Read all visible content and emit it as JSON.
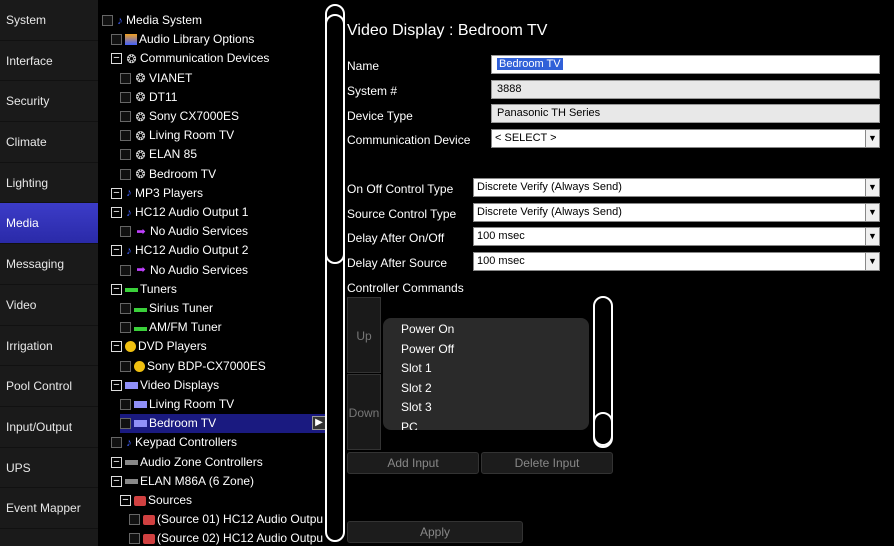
{
  "nav": {
    "items": [
      {
        "label": "System",
        "active": false
      },
      {
        "label": "Interface",
        "active": false
      },
      {
        "label": "Security",
        "active": false
      },
      {
        "label": "Climate",
        "active": false
      },
      {
        "label": "Lighting",
        "active": false
      },
      {
        "label": "Media",
        "active": true
      },
      {
        "label": "Messaging",
        "active": false
      },
      {
        "label": "Video",
        "active": false
      },
      {
        "label": "Irrigation",
        "active": false
      },
      {
        "label": "Pool Control",
        "active": false
      },
      {
        "label": "Input/Output",
        "active": false
      },
      {
        "label": "UPS",
        "active": false
      },
      {
        "label": "Event Mapper",
        "active": false
      }
    ]
  },
  "tree": {
    "items": [
      {
        "label": "Media System",
        "icon": "note-icon",
        "expander": "box"
      },
      {
        "label": "Audio Library Options",
        "icon": "library-icon",
        "expander": "box"
      },
      {
        "label": "Communication Devices",
        "icon": "satellite-icon",
        "expander": "minus"
      },
      {
        "label": "VIANET",
        "icon": "satellite-icon",
        "expander": "box"
      },
      {
        "label": "DT11",
        "icon": "satellite-icon",
        "expander": "box"
      },
      {
        "label": "Sony CX7000ES",
        "icon": "satellite-icon",
        "expander": "box"
      },
      {
        "label": "Living Room TV",
        "icon": "satellite-icon",
        "expander": "box"
      },
      {
        "label": "ELAN 85",
        "icon": "satellite-icon",
        "expander": "box"
      },
      {
        "label": "Bedroom TV",
        "icon": "satellite-icon",
        "expander": "box"
      },
      {
        "label": "MP3 Players",
        "icon": "note-icon",
        "expander": "minus"
      },
      {
        "label": "HC12 Audio Output 1",
        "icon": "note-icon",
        "expander": "minus"
      },
      {
        "label": "No Audio Services",
        "icon": "arrow-icon",
        "expander": "box"
      },
      {
        "label": "HC12 Audio Output 2",
        "icon": "note-icon",
        "expander": "minus"
      },
      {
        "label": "No Audio Services",
        "icon": "arrow-icon",
        "expander": "box"
      },
      {
        "label": "Tuners",
        "icon": "tuner-icon",
        "expander": "minus"
      },
      {
        "label": "Sirius Tuner",
        "icon": "tuner-icon",
        "expander": "box"
      },
      {
        "label": "AM/FM Tuner",
        "icon": "tuner-icon",
        "expander": "box"
      },
      {
        "label": "DVD Players",
        "icon": "disc-icon",
        "expander": "minus"
      },
      {
        "label": "Sony BDP-CX7000ES",
        "icon": "disc-icon",
        "expander": "box"
      },
      {
        "label": "Video Displays",
        "icon": "display-icon",
        "expander": "minus"
      },
      {
        "label": "Living Room TV",
        "icon": "display-icon",
        "expander": "box"
      },
      {
        "label": "Bedroom TV",
        "icon": "display-icon",
        "expander": "box",
        "selected": true
      },
      {
        "label": "Keypad Controllers",
        "icon": "note-icon",
        "expander": "box"
      },
      {
        "label": "Audio Zone Controllers",
        "icon": "controller-icon",
        "expander": "minus"
      },
      {
        "label": "ELAN M86A (6 Zone)",
        "icon": "controller-icon",
        "expander": "minus"
      },
      {
        "label": "Sources",
        "icon": "sources-icon",
        "expander": "minus"
      },
      {
        "label": "(Source 01) HC12 Audio Outpu",
        "icon": "sources-icon",
        "expander": "box"
      },
      {
        "label": "(Source 02) HC12 Audio Outpu",
        "icon": "sources-icon",
        "expander": "box"
      }
    ]
  },
  "form": {
    "title": "Video Display : Bedroom TV",
    "name_label": "Name",
    "name_value": "Bedroom TV",
    "system_label": "System #",
    "system_value": "3888",
    "device_type_label": "Device Type",
    "device_type_value": "Panasonic TH Series",
    "comm_device_label": "Communication Device",
    "comm_device_value": "< SELECT >",
    "onoff_label": "On Off Control Type",
    "onoff_value": "Discrete Verify (Always Send)",
    "source_ctrl_label": "Source Control Type",
    "source_ctrl_value": "Discrete Verify (Always Send)",
    "delay_onoff_label": "Delay After On/Off",
    "delay_onoff_value": "100 msec",
    "delay_source_label": "Delay After Source",
    "delay_source_value": "100 msec",
    "commands_label": "Controller Commands",
    "up_label": "Up",
    "down_label": "Down",
    "commands": [
      "Power On",
      "Power Off",
      "Slot 1",
      "Slot 2",
      "Slot 3",
      "PC"
    ],
    "add_input_label": "Add Input",
    "delete_input_label": "Delete Input",
    "apply_label": "Apply"
  }
}
